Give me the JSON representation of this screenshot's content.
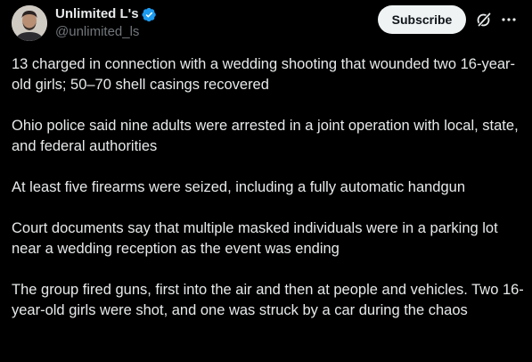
{
  "author": {
    "display_name": "Unlimited L's",
    "handle": "@unlimited_ls",
    "verified": true
  },
  "actions": {
    "subscribe_label": "Subscribe",
    "grok_icon": "grok-icon",
    "more_icon": "more-icon"
  },
  "colors": {
    "background": "#000000",
    "text_primary": "#e7e9ea",
    "text_secondary": "#71767b",
    "verified_blue": "#1d9bf0",
    "button_bg": "#eff3f4"
  },
  "post": {
    "paragraphs": [
      "13 charged in connection with a wedding shooting that wounded two 16-year-old girls; 50–70 shell casings recovered",
      "Ohio police said nine adults were arrested in a joint operation with local, state, and federal authorities",
      "At least five firearms were seized, including a fully automatic handgun",
      "Court documents say that multiple masked individuals were in a parking lot near a wedding reception as the event was ending",
      "The group fired guns, first into the air and then at people and vehicles. Two 16-year-old girls were shot, and one was struck by a car during the chaos"
    ]
  }
}
